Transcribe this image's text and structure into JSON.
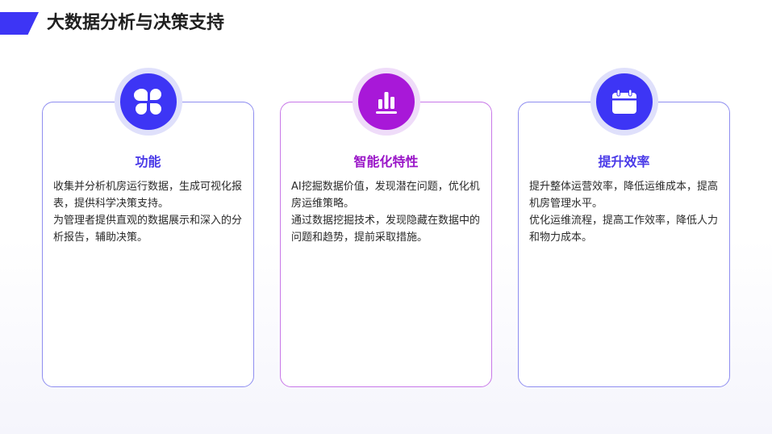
{
  "page": {
    "title": "大数据分析与决策支持"
  },
  "colors": {
    "accent_blue": "#3d35f5",
    "accent_purple": "#a818d8",
    "title_blue": "#4a3ae8",
    "title_purple": "#9a16c8"
  },
  "cards": [
    {
      "icon": "clover-icon",
      "title": "功能",
      "paragraphs": [
        "收集并分析机房运行数据，生成可视化报表，提供科学决策支持。",
        "为管理者提供直观的数据展示和深入的分析报告，辅助决策。"
      ]
    },
    {
      "icon": "bar-chart-icon",
      "title": "智能化特性",
      "paragraphs": [
        "AI挖掘数据价值，发现潜在问题，优化机房运维策略。",
        "通过数据挖掘技术，发现隐藏在数据中的问题和趋势，提前采取措施。"
      ]
    },
    {
      "icon": "calendar-icon",
      "title": "提升效率",
      "paragraphs": [
        "提升整体运营效率，降低运维成本，提高机房管理水平。",
        "优化运维流程，提高工作效率，降低人力和物力成本。"
      ]
    }
  ]
}
